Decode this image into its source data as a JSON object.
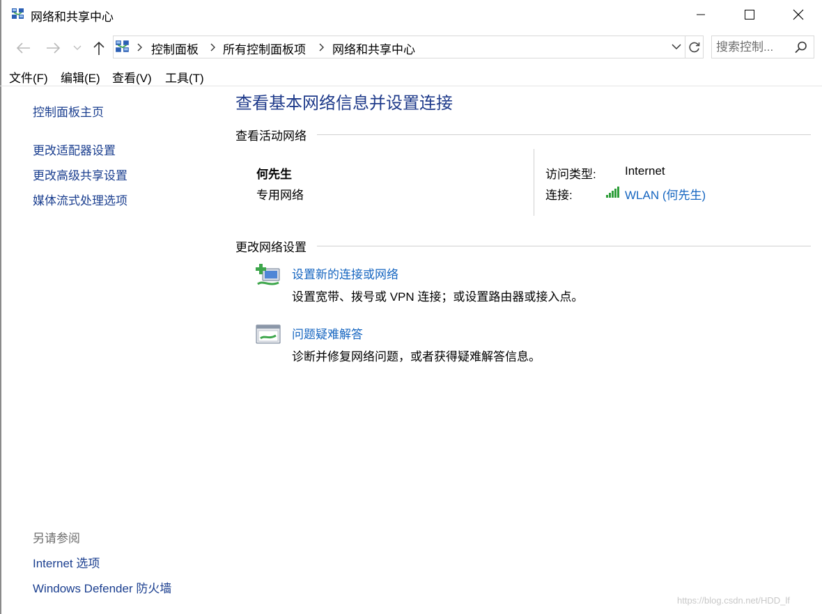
{
  "window": {
    "title": "网络和共享中心"
  },
  "address": {
    "breadcrumbs": [
      "控制面板",
      "所有控制面板项",
      "网络和共享中心"
    ]
  },
  "search": {
    "placeholder": "搜索控制..."
  },
  "menu": [
    "文件(F)",
    "编辑(E)",
    "查看(V)",
    "工具(T)"
  ],
  "sidebar": {
    "home": "控制面板主页",
    "links": [
      "更改适配器设置",
      "更改高级共享设置",
      "媒体流式处理选项"
    ],
    "see_also_title": "另请参阅",
    "see_also": [
      "Internet 选项",
      "Windows Defender 防火墙"
    ]
  },
  "main": {
    "title": "查看基本网络信息并设置连接",
    "active_networks_heading": "查看活动网络",
    "network": {
      "name": "何先生",
      "type": "专用网络",
      "access_type_label": "访问类型:",
      "access_type_value": "Internet",
      "connection_label": "连接:",
      "connection_value": "WLAN (何先生)"
    },
    "change_settings_heading": "更改网络设置",
    "tasks": [
      {
        "title": "设置新的连接或网络",
        "description": "设置宽带、拨号或 VPN 连接；或设置路由器或接入点。"
      },
      {
        "title": "问题疑难解答",
        "description": "诊断并修复网络问题，或者获得疑难解答信息。"
      }
    ]
  },
  "watermark": "https://blog.csdn.net/HDD_lf",
  "icons": {
    "app": "network-center-icon",
    "back": "back-arrow-icon",
    "forward": "forward-arrow-icon",
    "recent": "chevron-down-icon",
    "up": "up-arrow-icon",
    "refresh": "refresh-icon",
    "search": "search-icon",
    "signal": "wifi-signal-icon",
    "new_connection": "new-connection-icon",
    "troubleshoot": "troubleshoot-icon"
  },
  "colors": {
    "link": "#1565c0",
    "title": "#1e3a8a",
    "nav_link": "#1a3e8f",
    "muted": "#6d6d6d",
    "signal": "#2e9e3a"
  }
}
